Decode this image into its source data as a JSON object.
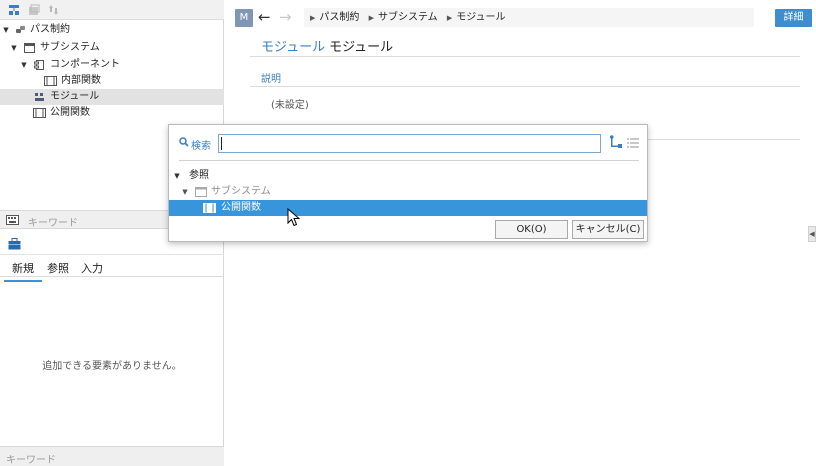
{
  "left_tree": {
    "items": [
      {
        "label": "パス制約"
      },
      {
        "label": "サブシステム"
      },
      {
        "label": "コンポーネント"
      },
      {
        "label": "内部関数"
      },
      {
        "label": "モジュール"
      },
      {
        "label": "公開関数"
      }
    ],
    "search_placeholder": "キーワード"
  },
  "lower_panel": {
    "tabs": [
      {
        "label": "新規"
      },
      {
        "label": "参照"
      },
      {
        "label": "入力"
      }
    ],
    "empty_message": "追加できる要素がありません。",
    "search_placeholder": "キーワード"
  },
  "main": {
    "badge": "M",
    "breadcrumb": [
      "パス制約",
      "サブシステム",
      "モジュール"
    ],
    "detail_button": "詳細",
    "title_type": "モジュール",
    "title_name": "モジュール",
    "description_label": "説明",
    "description_value": "(未設定)"
  },
  "dialog": {
    "search_label": "検索",
    "search_value": "",
    "tree": [
      {
        "label": "参照"
      },
      {
        "label": "サブシステム"
      },
      {
        "label": "公開関数"
      }
    ],
    "ok_label": "OK(O)",
    "cancel_label": "キャンセル(C)"
  },
  "colors": {
    "accent": "#3b7ec7",
    "selection": "#3795db",
    "detail_button": "#3f8ccf"
  },
  "icons": {
    "toolbar": [
      "hierarchy-icon",
      "stack-icon",
      "move-icon"
    ],
    "tree": [
      "link-icon",
      "window-icon",
      "component-icon",
      "function-icon",
      "module-icon",
      "function-icon"
    ]
  }
}
